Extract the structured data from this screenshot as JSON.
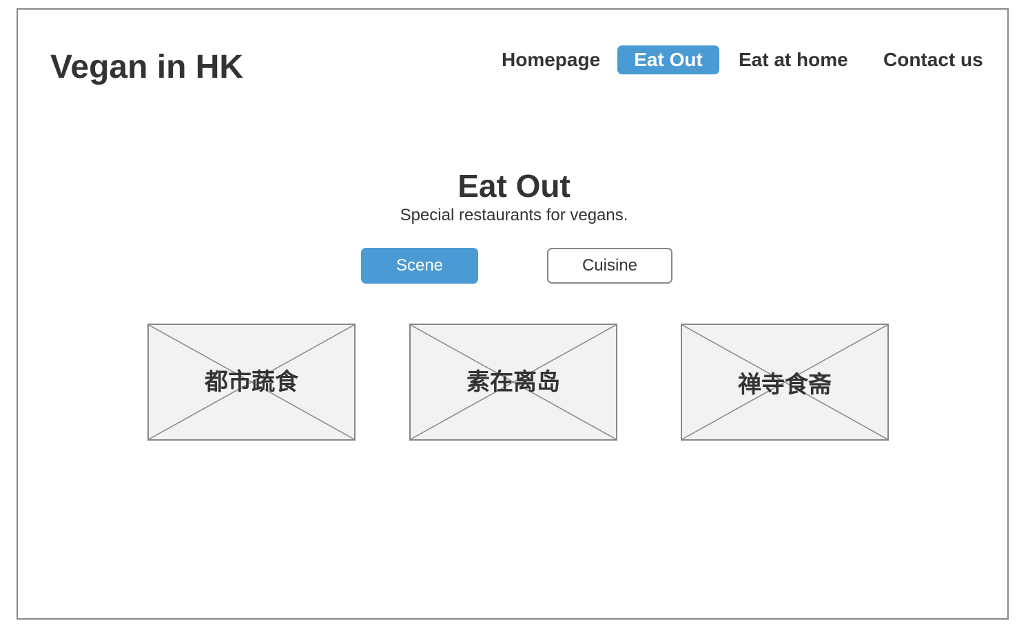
{
  "header": {
    "logo": "Vegan in HK",
    "nav": [
      {
        "label": "Homepage",
        "active": false
      },
      {
        "label": "Eat Out",
        "active": true
      },
      {
        "label": "Eat at home",
        "active": false
      },
      {
        "label": "Contact us",
        "active": false
      }
    ]
  },
  "main": {
    "title": "Eat Out",
    "subtitle": "Special restaurants for vegans.",
    "tabs": [
      {
        "label": "Scene",
        "selected": true
      },
      {
        "label": "Cuisine",
        "selected": false
      }
    ],
    "cards": [
      {
        "label": "都市蔬食"
      },
      {
        "label": "素在离岛"
      },
      {
        "label": "禅寺食斋"
      }
    ]
  },
  "colors": {
    "accent": "#4a9ad4",
    "text": "#333333",
    "border": "#888888",
    "placeholder_fill": "#f2f2f2"
  }
}
